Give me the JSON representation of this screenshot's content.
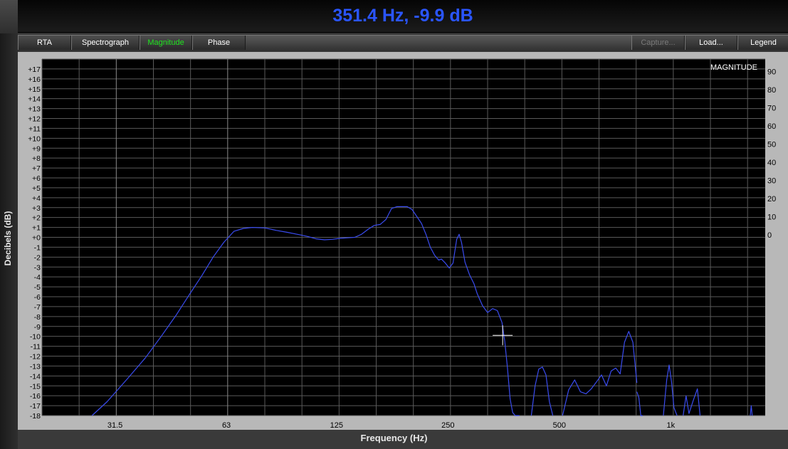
{
  "readout": "351.4 Hz, -9.9 dB",
  "toolbar": {
    "tabs": [
      "RTA",
      "Spectrograph",
      "Magnitude",
      "Phase"
    ],
    "active_tab": "Magnitude",
    "right_buttons": [
      "Capture...",
      "Load...",
      "Legend"
    ],
    "disabled_button": "Capture..."
  },
  "colors": {
    "readout": "#2a55ff",
    "active_tab": "#1fe41f",
    "trace": "#3a4cf0",
    "plot_bg": "#000000",
    "frame": "#b8b8b8"
  },
  "chart_data": {
    "type": "line",
    "title": "",
    "plot_label": "MAGNITUDE",
    "xlabel": "Frequency (Hz)",
    "ylabel": "Decibels (dB)",
    "x_scale": "log",
    "xlim": [
      20,
      1800
    ],
    "x_ticks": [
      {
        "value": 31.5,
        "label": "31.5"
      },
      {
        "value": 63,
        "label": "63"
      },
      {
        "value": 125,
        "label": "125"
      },
      {
        "value": 250,
        "label": "250"
      },
      {
        "value": 500,
        "label": "500"
      },
      {
        "value": 1000,
        "label": "1k"
      }
    ],
    "ylim": [
      -18,
      18
    ],
    "y_ticks_left": [
      "-18",
      "-17",
      "-16",
      "-15",
      "-14",
      "-13",
      "-12",
      "-11",
      "-10",
      "-9",
      "-8",
      "-7",
      "-6",
      "-5",
      "-4",
      "-3",
      "-2",
      "-1",
      "+0",
      "+1",
      "+2",
      "+3",
      "+4",
      "+5",
      "+6",
      "+7",
      "+8",
      "+9",
      "+10",
      "+11",
      "+12",
      "+13",
      "+14",
      "+15",
      "+16",
      "+17"
    ],
    "y_ticks_right": [
      "0",
      "10",
      "20",
      "30",
      "40",
      "50",
      "60",
      "70",
      "80",
      "90"
    ],
    "grid": true,
    "cursor": {
      "x": 351.4,
      "y": -9.9
    },
    "series": [
      {
        "color": "#3a4cf0",
        "x": [
          27.3,
          30,
          34,
          38,
          42,
          46,
          50,
          54,
          58,
          62,
          66,
          70,
          74,
          80,
          86,
          92,
          98,
          104,
          110,
          116,
          122,
          128,
          134,
          140,
          146,
          152,
          158,
          164,
          170,
          176,
          182,
          188,
          194,
          200,
          206,
          212,
          218,
          224,
          230,
          236,
          240,
          246,
          252,
          258,
          264,
          268,
          272,
          278,
          286,
          294,
          300,
          310,
          320,
          330,
          340,
          350,
          356,
          362,
          368,
          374,
          380,
          390
        ],
        "y": [
          -18,
          -16.6,
          -14.3,
          -12.2,
          -10,
          -7.9,
          -5.8,
          -3.9,
          -2,
          -0.5,
          0.6,
          0.9,
          1,
          0.95,
          0.7,
          0.5,
          0.3,
          0.1,
          -0.15,
          -0.25,
          -0.2,
          -0.1,
          -0.05,
          0,
          0.3,
          0.8,
          1.2,
          1.3,
          1.8,
          2.9,
          3.1,
          3.1,
          3.1,
          2.8,
          2.1,
          1.4,
          0.3,
          -1,
          -1.8,
          -2.3,
          -2.2,
          -2.6,
          -3.1,
          -2.6,
          -0.2,
          0.3,
          -0.5,
          -2.5,
          -3.8,
          -4.7,
          -5.7,
          -6.9,
          -7.6,
          -7.2,
          -7.4,
          -8.6,
          -10.5,
          -13.2,
          -16.3,
          -17.7,
          -18,
          -18
        ]
      },
      {
        "color": "#3a4cf0",
        "x": [
          420,
          430,
          440,
          450,
          460,
          470,
          480
        ],
        "y": [
          -18,
          -15,
          -13.3,
          -13.1,
          -13.9,
          -16.6,
          -18
        ]
      },
      {
        "color": "#3a4cf0",
        "x": [
          510,
          530,
          550,
          570,
          590,
          610,
          630,
          650,
          670,
          690,
          710,
          730,
          750,
          770,
          790,
          810
        ],
        "y": [
          -18,
          -15.4,
          -14.4,
          -15.6,
          -15.8,
          -15.3,
          -14.6,
          -13.9,
          -15,
          -13.5,
          -13.2,
          -13.8,
          -10.6,
          -9.5,
          -10.6,
          -14.7
        ]
      },
      {
        "color": "#3a4cf0",
        "x": [
          810,
          820,
          830,
          840
        ],
        "y": [
          -15.6,
          -16.2,
          -18,
          -18
        ]
      },
      {
        "color": "#3a4cf0",
        "x": [
          955,
          975,
          990,
          1005,
          1020,
          1040
        ],
        "y": [
          -18,
          -14.4,
          -12.9,
          -14.6,
          -17.2,
          -18
        ]
      },
      {
        "color": "#3a4cf0",
        "x": [
          1080,
          1100,
          1120,
          1150,
          1180,
          1200
        ],
        "y": [
          -18,
          -16,
          -17.8,
          -16.5,
          -15.3,
          -18
        ]
      },
      {
        "color": "#3a4cf0",
        "x": [
          1640,
          1650,
          1660
        ],
        "y": [
          -18,
          -17,
          -18
        ]
      }
    ]
  }
}
